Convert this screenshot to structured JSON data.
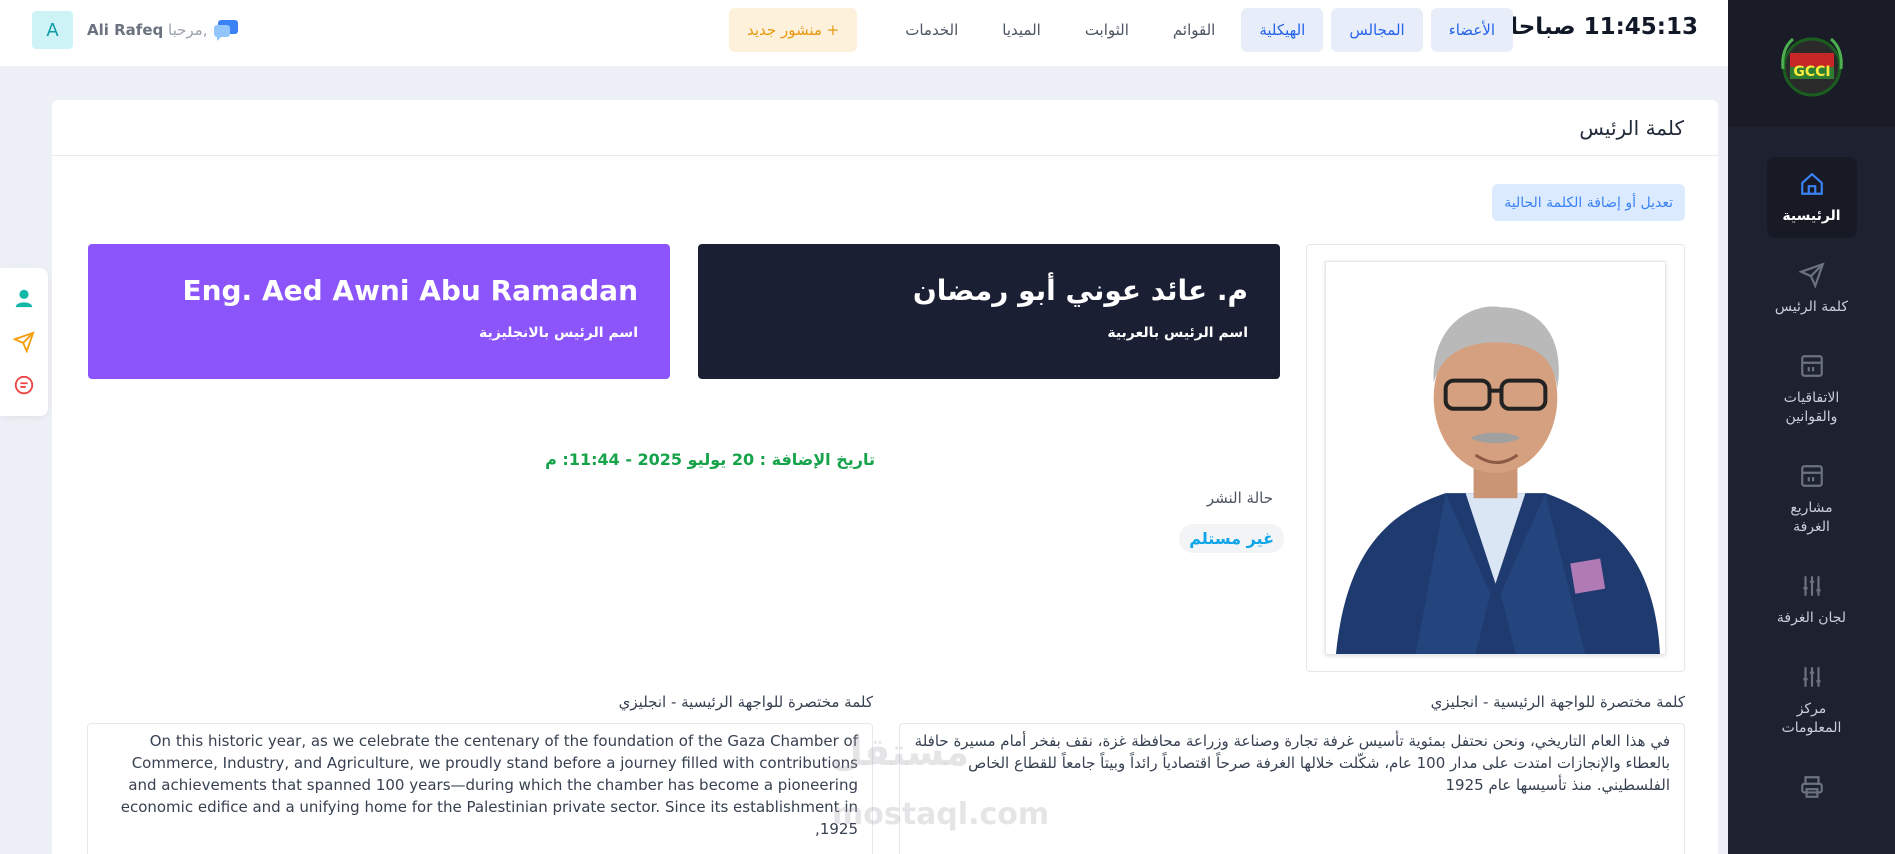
{
  "topbar": {
    "clock": "11:45:13 صباحا",
    "nav": [
      {
        "label": "الأعضاء",
        "hl": true
      },
      {
        "label": "المجالس",
        "hl": true
      },
      {
        "label": "الهيكلية",
        "hl": true
      },
      {
        "label": "القوائم",
        "hl": false
      },
      {
        "label": "الثوابت",
        "hl": false
      },
      {
        "label": "الميديا",
        "hl": false
      },
      {
        "label": "الخدمات",
        "hl": false
      }
    ],
    "new_post": "منشور جديد +",
    "greeting_prefix": "مرحبا,",
    "user_name": "Ali Rafeq",
    "avatar_letter": "A"
  },
  "sidebar": {
    "items": [
      {
        "label": "الرئيسية",
        "icon": "home-icon",
        "active": true
      },
      {
        "label": "كلمة الرئيس",
        "icon": "send-icon",
        "active": false
      },
      {
        "label": "الاتفاقيات والقوانين",
        "icon": "layout-icon",
        "active": false
      },
      {
        "label": "مشاريع الغرفة",
        "icon": "layout-icon",
        "active": false
      },
      {
        "label": "لجان الغرفة",
        "icon": "sliders-icon",
        "active": false
      },
      {
        "label": "مركز المعلومات",
        "icon": "sliders-icon",
        "active": false
      },
      {
        "label": "",
        "icon": "printer-icon",
        "active": false
      }
    ]
  },
  "page": {
    "title": "كلمة الرئيس",
    "edit_button": "تعديل أو إضافة الكلمة الحالية",
    "name_ar": "م. عائد عوني أبو رمضان",
    "name_ar_caption": "اسم الرئيس بالعربية",
    "name_en": "Eng. Aed Awni Abu Ramadan",
    "name_en_caption": "اسم الرئيس بالانجليزية",
    "date_added": "تاريخ الإضافة : 20 يوليو 2025 - 11:44: م",
    "publish_label": "حالة النشر",
    "publish_status": "غير مستلم",
    "label_ar": "كلمة مختصرة للواجهة الرئيسية - انجليزي",
    "label_en": "كلمة مختصرة للواجهة الرئيسية - انجليزي",
    "text_ar": "في هذا العام التاريخي، ونحن نحتفل بمئوية تأسيس غرفة تجارة وصناعة وزراعة محافظة غزة، نقف بفخر أمام مسيرة حافلة بالعطاء والإنجازات امتدت على مدار 100 عام، شكّلت خلالها الغرفة صرحاً اقتصادياً رائداً وبيتاً جامعاً للقطاع الخاص الفلسطيني. منذ تأسيسها عام 1925",
    "text_en": "On this historic year, as we celebrate the centenary of the foundation of the Gaza Chamber of Commerce, Industry, and Agriculture, we proudly stand before a journey filled with contributions and achievements that spanned 100 years—during which the chamber has become a pioneering economic edifice and a unifying home for the Palestinian private sector. Since its establishment in 1925,",
    "watermark": "مستقل",
    "watermark_url": "mostaql.com"
  },
  "colors": {
    "sidebar_bg": "#1e2130",
    "accent_blue": "#2563eb",
    "name_ar_bg": "#1b1f33",
    "name_en_bg": "#8b55fb",
    "date_green": "#16a34a"
  }
}
